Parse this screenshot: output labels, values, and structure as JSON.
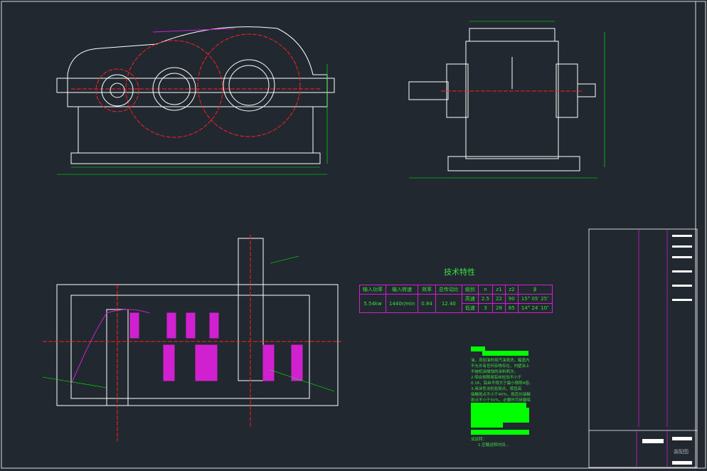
{
  "technical_characteristics": {
    "title": "技术特性",
    "headers": [
      "输入功率",
      "输入转速",
      "效率",
      "总传动比",
      "级别",
      "n",
      "z1",
      "z2",
      "β"
    ],
    "input_power": "5.54kw",
    "input_speed": "1440r/min",
    "efficiency": "0.84",
    "total_ratio": "12.40",
    "rows": [
      {
        "stage": "高速",
        "m": "2.5",
        "z1": "22",
        "z2": "90",
        "beta": "15° 05′ 25″"
      },
      {
        "stage": "低速",
        "m": "3",
        "z1": "28",
        "z2": "85",
        "beta": "14° 24′ 10″"
      }
    ]
  },
  "notes": {
    "lines": [
      "油，添加油时用汽油清洗，箱盖内",
      "不允许有任何杂物存在，内壁涂上",
      "不被机油侵蚀的涂料两次。",
      "2.啮合侧隙用铅丝检验不小于",
      "0.16，铅丝不得大于最小侧隙4倍。",
      "3.用涂色法检验斑点，按齿高",
      "接触斑点不小于40%，按齿长接触",
      "斑点不小于50%，必要时可研磨啮",
      "试运转：",
      "1.空载运转时间..."
    ]
  },
  "title_block": {
    "name": "装配图"
  },
  "colors": {
    "background": "#212830",
    "line": "#ffffff",
    "green": "#00ff00",
    "red": "#ff2020",
    "magenta": "#d020d0"
  }
}
